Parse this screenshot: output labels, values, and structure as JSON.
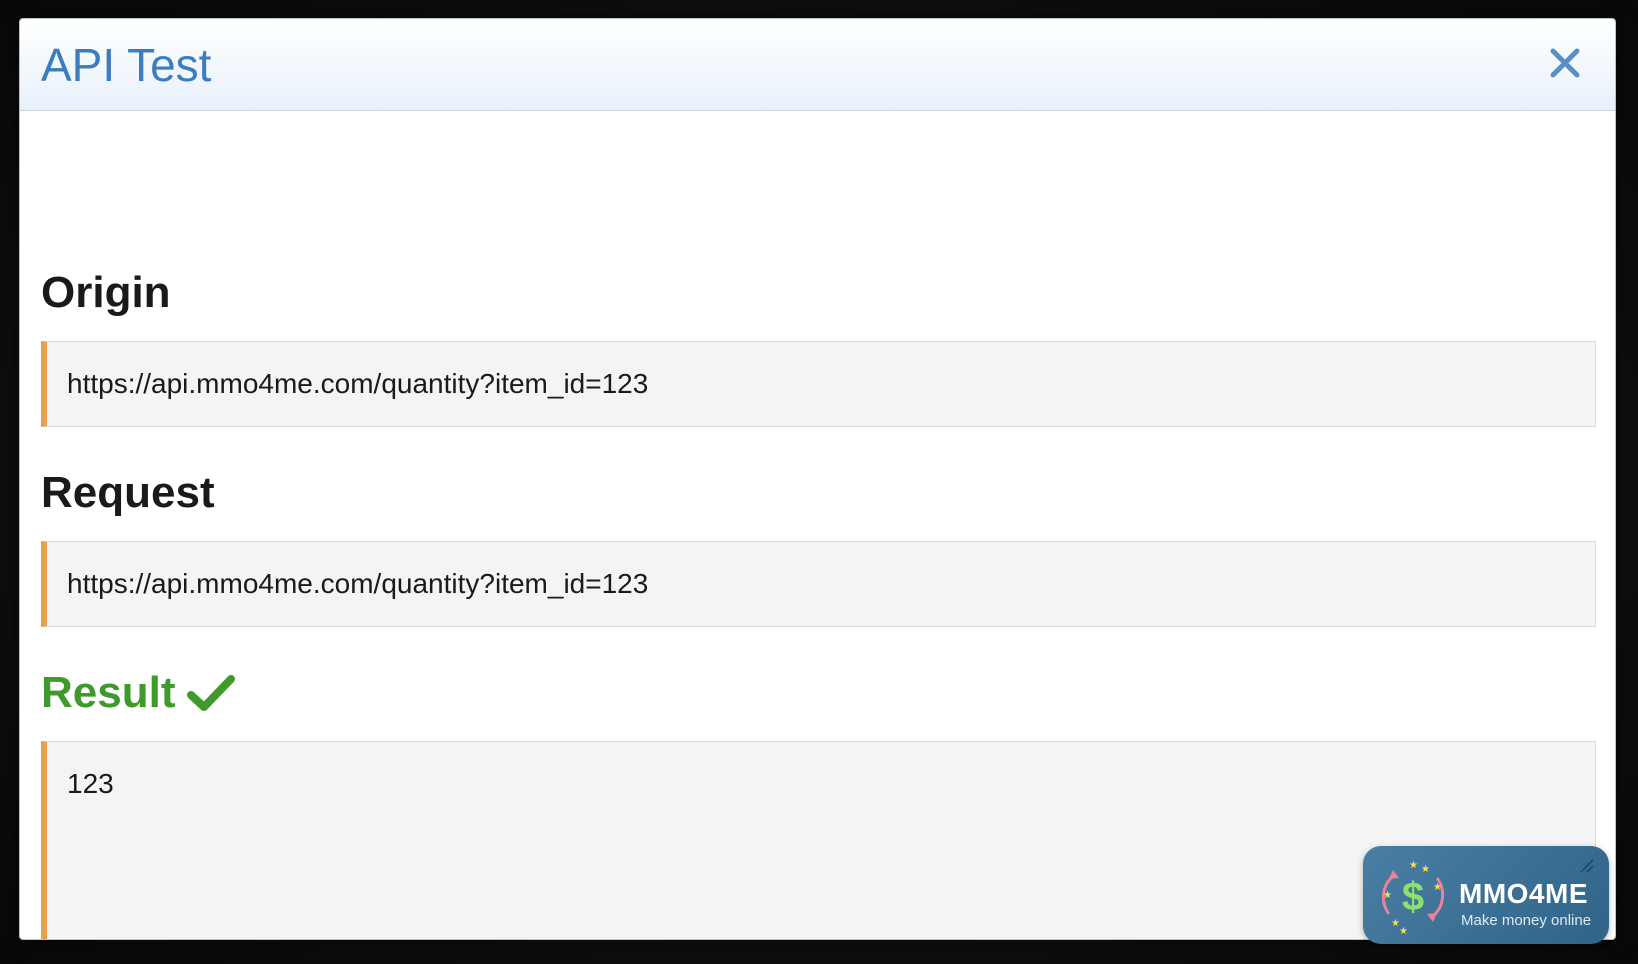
{
  "dialog": {
    "title": "API Test",
    "close_icon": "close-icon"
  },
  "sections": {
    "origin": {
      "heading": "Origin",
      "value": "https://api.mmo4me.com/quantity?item_id=123"
    },
    "request": {
      "heading": "Request",
      "value": "https://api.mmo4me.com/quantity?item_id=123"
    },
    "result": {
      "heading": "Result",
      "status_icon": "checkmark-icon",
      "value": "123"
    }
  },
  "watermark": {
    "brand": "MMO4ME",
    "tagline": "Make money online",
    "logo_icon": "dollar-coin-logo"
  },
  "colors": {
    "title_blue": "#3b7dc1",
    "success_green": "#3f9a2b",
    "accent_border": "#e8a04a",
    "code_bg": "#f4f4f4"
  }
}
